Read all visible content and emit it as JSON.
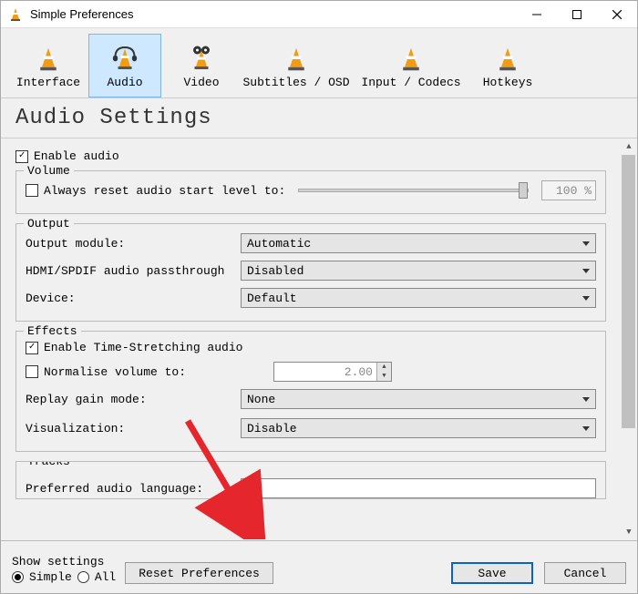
{
  "window": {
    "title": "Simple Preferences"
  },
  "tabs": {
    "interface": "Interface",
    "audio": "Audio",
    "video": "Video",
    "subtitles": "Subtitles / OSD",
    "input": "Input / Codecs",
    "hotkeys": "Hotkeys"
  },
  "page": {
    "title": "Audio Settings"
  },
  "main": {
    "enable_audio": "Enable audio",
    "volume": {
      "legend": "Volume",
      "reset_label": "Always reset audio start level to:",
      "percent": "100 %"
    },
    "output": {
      "legend": "Output",
      "module_label": "Output module:",
      "module_value": "Automatic",
      "passthrough_label": "HDMI/SPDIF audio passthrough",
      "passthrough_value": "Disabled",
      "device_label": "Device:",
      "device_value": "Default"
    },
    "effects": {
      "legend": "Effects",
      "timestretch": "Enable Time-Stretching audio",
      "normalise_label": "Normalise volume to:",
      "normalise_value": "2.00",
      "replay_label": "Replay gain mode:",
      "replay_value": "None",
      "visualization_label": "Visualization:",
      "visualization_value": "Disable"
    },
    "tracks": {
      "legend": "Tracks",
      "pref_lang_label": "Preferred audio language:"
    }
  },
  "footer": {
    "show_settings": "Show settings",
    "simple": "Simple",
    "all": "All",
    "reset": "Reset Preferences",
    "save": "Save",
    "cancel": "Cancel"
  }
}
